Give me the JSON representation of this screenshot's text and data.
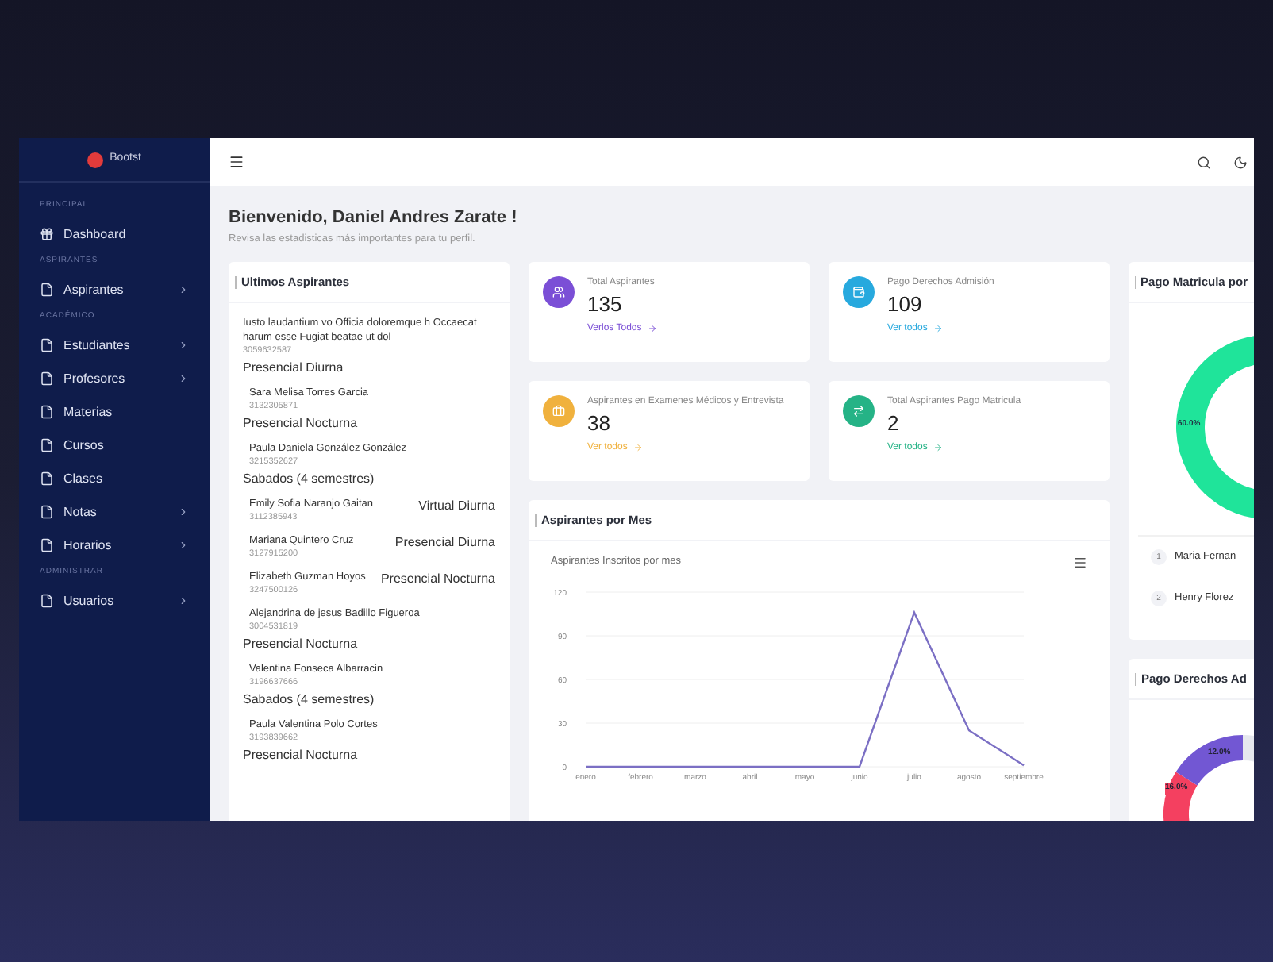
{
  "sidebar": {
    "logo": "Bootst",
    "sections": [
      {
        "title": "PRINCIPAL",
        "items": [
          {
            "label": "Dashboard",
            "submenu": false
          }
        ]
      },
      {
        "title": "ASPIRANTES",
        "items": [
          {
            "label": "Aspirantes",
            "submenu": true
          }
        ]
      },
      {
        "title": "ACADÉMICO",
        "items": [
          {
            "label": "Estudiantes",
            "submenu": true
          },
          {
            "label": "Profesores",
            "submenu": true
          },
          {
            "label": "Materias",
            "submenu": false
          },
          {
            "label": "Cursos",
            "submenu": false
          },
          {
            "label": "Clases",
            "submenu": false
          },
          {
            "label": "Notas",
            "submenu": true
          },
          {
            "label": "Horarios",
            "submenu": true
          }
        ]
      },
      {
        "title": "ADMINISTRAR",
        "items": [
          {
            "label": "Usuarios",
            "submenu": true
          }
        ]
      }
    ]
  },
  "header": {
    "title": "Bienvenido, Daniel Andres Zarate !",
    "subtitle": "Revisa las estadisticas más importantes para tu perfil."
  },
  "recent": {
    "title": "Ultimos Aspirantes",
    "items": [
      {
        "kind": "stacked",
        "name": "Iusto laudantium vo Officia doloremque h Occaecat harum esse Fugiat beatae ut dol",
        "phone": "3059632587",
        "program": "Presencial Diurna"
      },
      {
        "kind": "stacked",
        "name": "Sara Melisa Torres Garcia",
        "phone": "3132305871",
        "program": "Presencial Nocturna"
      },
      {
        "kind": "stacked",
        "name": "Paula Daniela González González",
        "phone": "3215352627",
        "program": "Sabados (4 semestres)"
      },
      {
        "kind": "inline",
        "name": "Emily Sofia Naranjo Gaitan",
        "phone": "3112385943",
        "program": "Virtual Diurna"
      },
      {
        "kind": "inline",
        "name": "Mariana Quintero Cruz",
        "phone": "3127915200",
        "program": "Presencial Diurna"
      },
      {
        "kind": "inline",
        "name": "Elizabeth Guzman Hoyos",
        "phone": "3247500126",
        "program": "Presencial Nocturna"
      },
      {
        "kind": "stacked",
        "name": "Alejandrina de jesus Badillo Figueroa",
        "phone": "3004531819",
        "program": "Presencial Nocturna"
      },
      {
        "kind": "stacked",
        "name": "Valentina Fonseca Albarracin",
        "phone": "3196637666",
        "program": "Sabados (4 semestres)"
      },
      {
        "kind": "stacked",
        "name": "Paula Valentina Polo Cortes",
        "phone": "3193839662",
        "program": "Presencial Nocturna"
      }
    ]
  },
  "stats": [
    {
      "label": "Total Aspirantes",
      "value": "135",
      "link": "Verlos Todos",
      "color": "#7b4fd6"
    },
    {
      "label": "Pago Derechos Admisión",
      "value": "109",
      "link": "Ver todos",
      "color": "#27a9de"
    },
    {
      "label": "Aspirantes en Examenes Médicos y Entrevista",
      "value": "38",
      "link": "Ver todos",
      "color": "#f0b13d"
    },
    {
      "label": "Total Aspirantes Pago Matricula",
      "value": "2",
      "link": "Ver todos",
      "color": "#25b386"
    }
  ],
  "monthly": {
    "title": "Aspirantes por Mes",
    "chart_data": {
      "type": "line",
      "title": "Aspirantes Inscritos por mes",
      "categories": [
        "enero",
        "febrero",
        "marzo",
        "abril",
        "mayo",
        "junio",
        "julio",
        "agosto",
        "septiembre"
      ],
      "series": [
        {
          "color": "#7b6fc4",
          "values": [
            0,
            0,
            0,
            0,
            0,
            0,
            106,
            25,
            1
          ]
        }
      ],
      "ylim": [
        0,
        120
      ],
      "yticks": [
        0,
        30,
        60,
        90,
        120
      ],
      "grid": true
    }
  },
  "matricula": {
    "title": "Pago Matricula por",
    "slice_label": "60.0%",
    "people": [
      {
        "rank": "1",
        "name": "Maria Fernan"
      },
      {
        "rank": "2",
        "name": "Henry Florez"
      }
    ]
  },
  "derechos": {
    "title": "Pago Derechos Ad",
    "slice_labels": [
      "12.0%",
      "16.0%"
    ]
  }
}
